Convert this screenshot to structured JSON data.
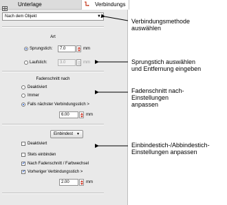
{
  "tabs": [
    {
      "label": "Unterlage"
    },
    {
      "label": "Verbindungs"
    }
  ],
  "method_dropdown": {
    "value": "Nach dem Objekt"
  },
  "art": {
    "heading": "Art",
    "sprungstich_label": "Sprungstich:",
    "sprungstich_value": "7.0",
    "sprungstich_unit": "mm",
    "laufstich_label": "Laufstich:",
    "laufstich_value": "3.0",
    "laufstich_unit": "mm"
  },
  "fadenschnitt": {
    "heading": "Fadenschnitt nach",
    "opt_deaktiviert": "Deaktiviert",
    "opt_immer": "Immer",
    "opt_falls": "Falls nächster Verbindungsstich >",
    "value": "6.00",
    "unit": "mm"
  },
  "einbindest": {
    "dropdown_value": "Einbindest",
    "deaktiviert": "Deaktiviert",
    "stets": "Stets einbinden",
    "nach": "Nach Fadenschnitt / Farbwechsel",
    "vorheriger": "Vorheriger Verbindungsstich >",
    "value": "2.00",
    "unit": "mm",
    "checkmark": "✓"
  },
  "callouts": {
    "c1_line1": "Verbindungsmethode",
    "c1_line2": "auswählen",
    "c2_line1": "Sprungstich auswählen",
    "c2_line2": "und Entfernung eingeben",
    "c3_line1": "Fadenschnitt nach-",
    "c3_line2": "Einstellungen",
    "c3_line3": "anpassen",
    "c4_line1": "Einbindestich-/Abbindestich-",
    "c4_line2": "Einstellungen anpassen"
  }
}
